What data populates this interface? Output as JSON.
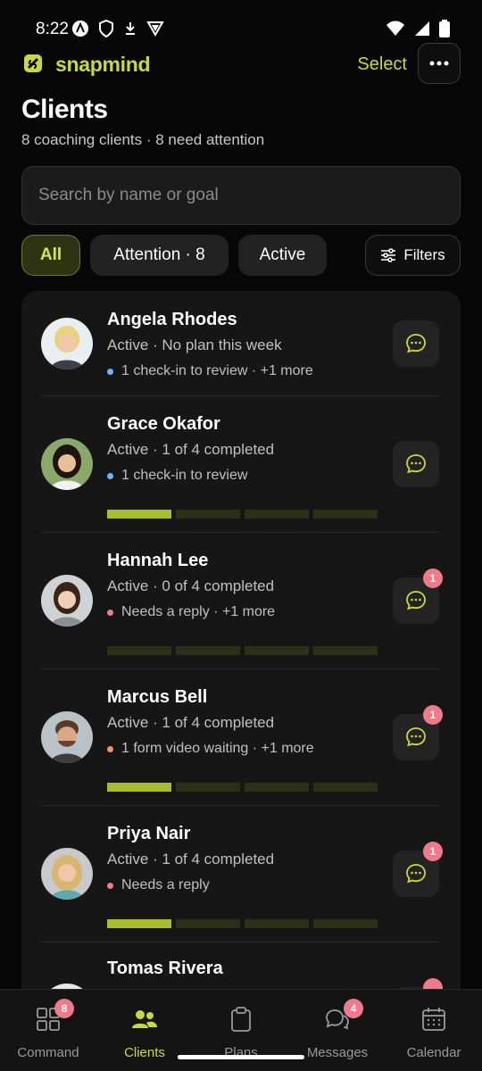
{
  "status_bar": {
    "time": "8:22"
  },
  "header": {
    "brand": "snapmind",
    "select_label": "Select"
  },
  "page": {
    "title": "Clients",
    "subtitle": "8 coaching clients · 8 need attention"
  },
  "search": {
    "placeholder": "Search by name or goal",
    "value": ""
  },
  "filters": {
    "all": "All",
    "attention": "Attention · 8",
    "active": "Active",
    "filters_label": "Filters"
  },
  "clients": [
    {
      "name": "Angela Rhodes",
      "status": "Active · No plan this week",
      "note": "1 check-in to review · +1 more",
      "note_color": "#6cb6ff",
      "badge": "",
      "progress": null
    },
    {
      "name": "Grace Okafor",
      "status": "Active · 1 of 4 completed",
      "note": "1 check-in to review",
      "note_color": "#6cb6ff",
      "badge": "",
      "progress": {
        "done": 1,
        "total": 4
      }
    },
    {
      "name": "Hannah Lee",
      "status": "Active · 0 of 4 completed",
      "note": "Needs a reply · +1 more",
      "note_color": "#f07a8a",
      "badge": "1",
      "progress": {
        "done": 0,
        "total": 4
      }
    },
    {
      "name": "Marcus Bell",
      "status": "Active · 1 of 4 completed",
      "note": "1 form video waiting · +1 more",
      "note_color": "#f0926a",
      "badge": "1",
      "progress": {
        "done": 1,
        "total": 4
      }
    },
    {
      "name": "Priya Nair",
      "status": "Active · 1 of 4 completed",
      "note": "Needs a reply",
      "note_color": "#f07a8a",
      "badge": "1",
      "progress": {
        "done": 1,
        "total": 4
      }
    },
    {
      "name": "Tomas Rivera"
    }
  ],
  "bottom_nav": [
    {
      "label": "Command",
      "icon": "grid-icon",
      "badge": "8",
      "active": false
    },
    {
      "label": "Clients",
      "icon": "people-icon",
      "badge": "",
      "active": true
    },
    {
      "label": "Plans",
      "icon": "clipboard-icon",
      "badge": "",
      "active": false
    },
    {
      "label": "Messages",
      "icon": "chat-bubbles-icon",
      "badge": "4",
      "active": false
    },
    {
      "label": "Calendar",
      "icon": "calendar-icon",
      "badge": "",
      "active": false
    }
  ],
  "colors": {
    "accent": "#c9d93c",
    "progress_filled": "#a9bd2c",
    "badge": "#f07a8a",
    "background": "#070707"
  }
}
